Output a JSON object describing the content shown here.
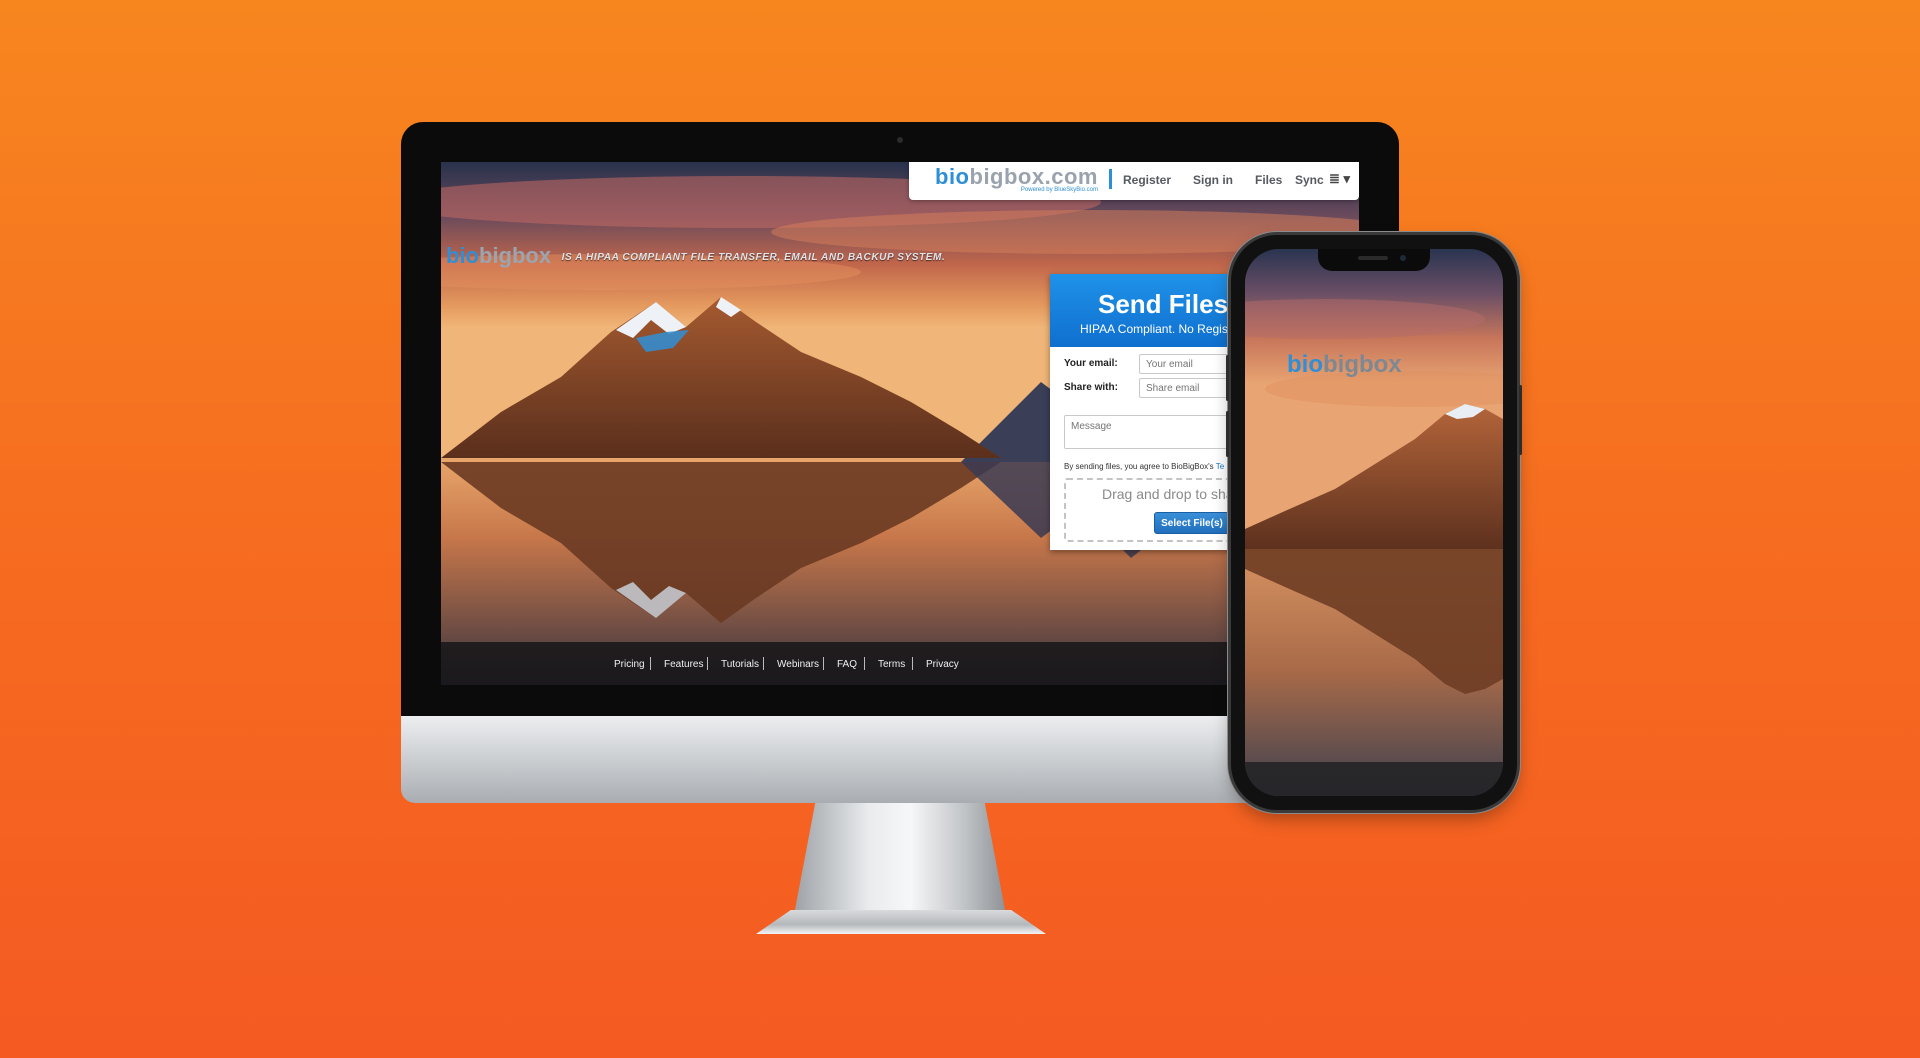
{
  "colors": {
    "background_top": "#f7861f",
    "background_bottom": "#f45a22",
    "brand_blue": "#2f8fd6",
    "panel_header_blue": "#1577d8"
  },
  "desktop": {
    "nav": {
      "logo_bio": "bio",
      "logo_rest": "bigbox.com",
      "logo_powered": "Powered by BlueSkyBio.com",
      "register": "Register",
      "sign_in": "Sign in",
      "files": "Files",
      "sync": "Sync",
      "menu_icon": "list-icon",
      "menu_glyph": "≣ ▾"
    },
    "hero": {
      "logo_bio": "bio",
      "logo_rest": "bigbox",
      "tagline": "IS A HIPAA COMPLIANT FILE TRANSFER, EMAIL AND BACKUP SYSTEM."
    },
    "send_panel": {
      "title": "Send Files",
      "subtitle": "HIPAA Compliant. No Registra",
      "email_label": "Your email:",
      "email_placeholder": "Your email",
      "share_label": "Share with:",
      "share_placeholder": "Share email",
      "message_placeholder": "Message",
      "terms_text": "By sending files, you agree to BioBigBox's ",
      "terms_link": "Te",
      "drop_text": "Drag and drop to sha",
      "select_button": "Select File(s)"
    },
    "footer": {
      "links": [
        "Pricing",
        "Features",
        "Tutorials",
        "Webinars",
        "FAQ",
        "Terms",
        "Privacy"
      ]
    }
  },
  "phone": {
    "logo_bio": "bio",
    "logo_rest": "bigbox"
  }
}
